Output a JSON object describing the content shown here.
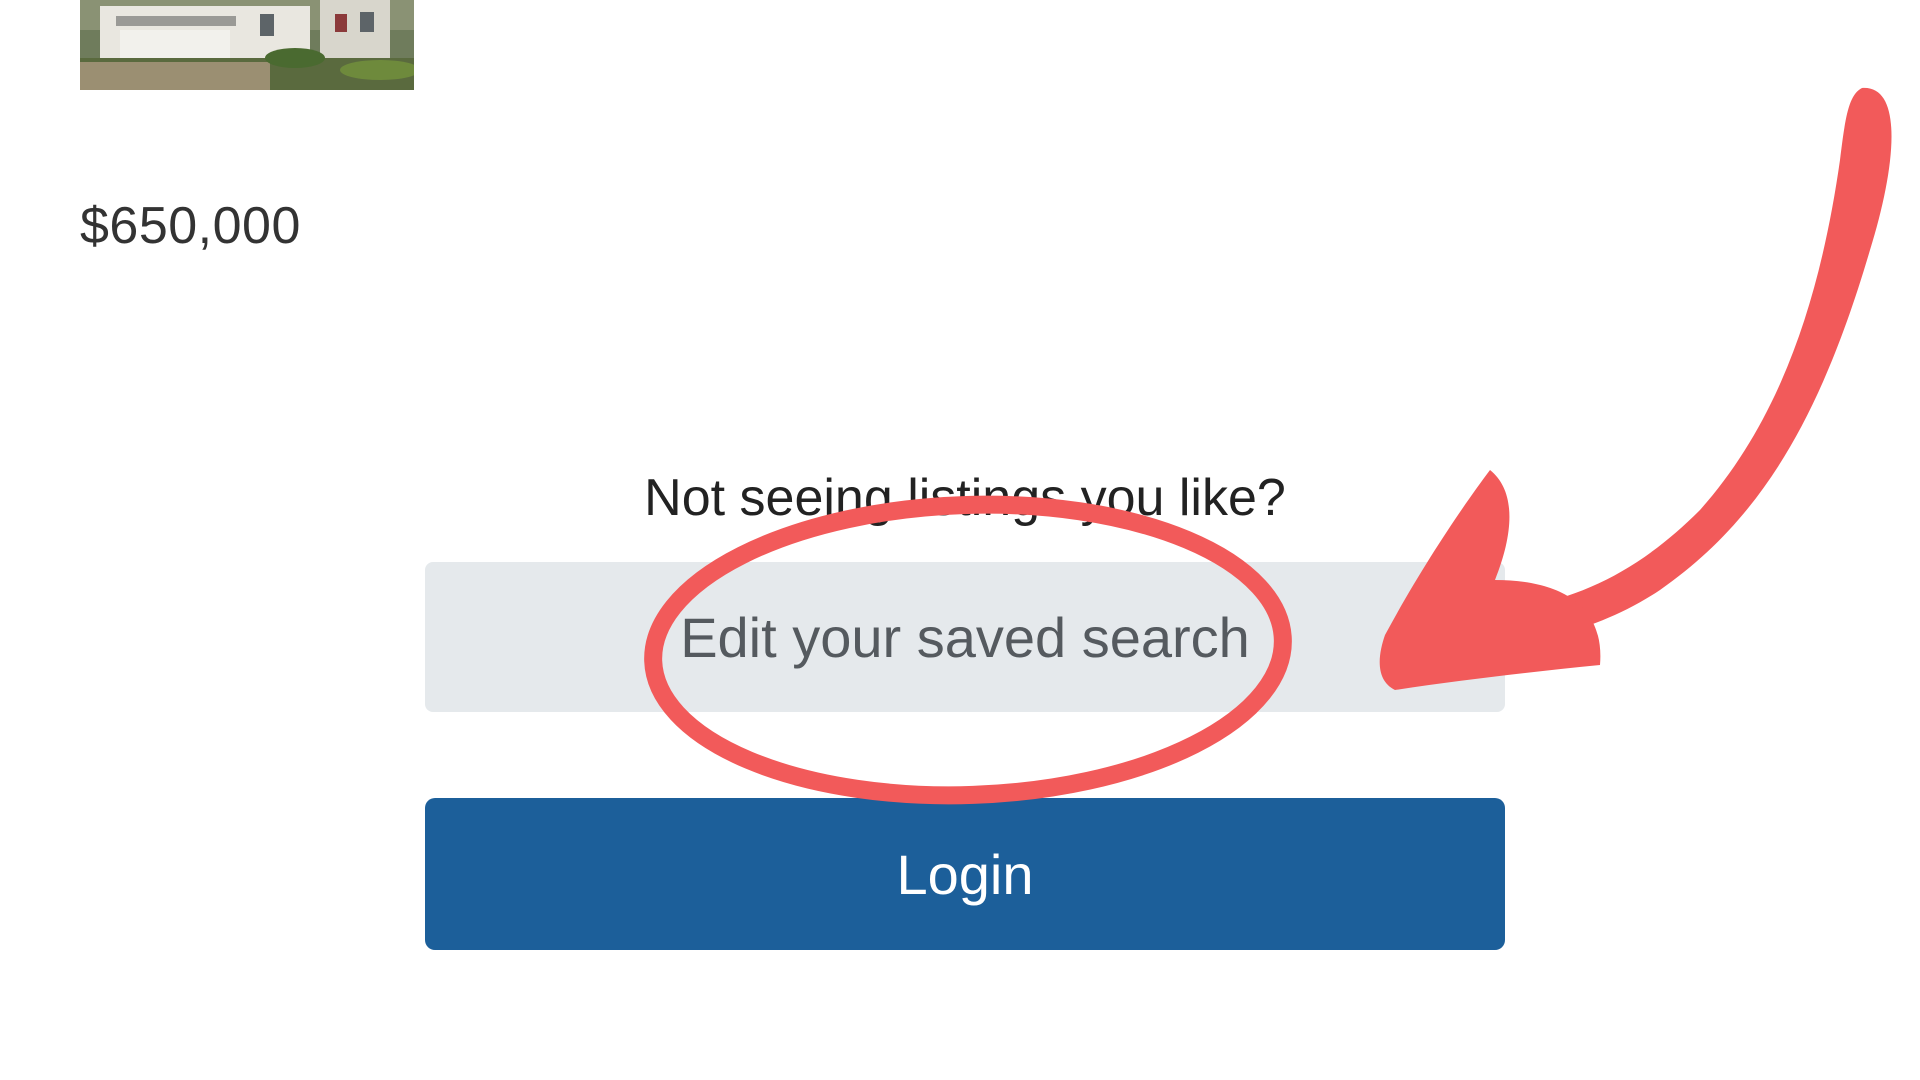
{
  "listing": {
    "price": "$650,000"
  },
  "cta": {
    "prompt": "Not seeing listings you like?",
    "edit_label": "Edit your saved search",
    "login_label": "Login"
  },
  "colors": {
    "edit_button_bg": "#e5e9ec",
    "login_button_bg": "#1c5f9a",
    "annotation": "#f25a5a"
  },
  "annotations": {
    "highlight": "ellipse-circle",
    "pointer": "curved-arrow-icon"
  }
}
